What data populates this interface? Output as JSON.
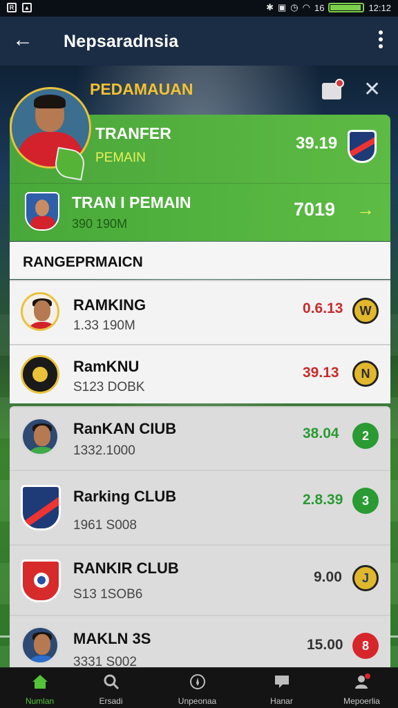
{
  "statusbar": {
    "time": "12:12",
    "battery_icon": "battery-icon",
    "signal_text": "16"
  },
  "appbar": {
    "title": "Nepsaradnsia",
    "back_icon": "arrow-left-icon",
    "menu_icon": "more-vert-icon"
  },
  "section": {
    "title": "PEDAMAUAN",
    "bag_icon": "bag-icon",
    "close_icon": "close-icon"
  },
  "transfer_card": {
    "title": "TRANFER",
    "subtitle": "PEMAIN",
    "value": "39.19",
    "badge_icon": "club-crest-icon"
  },
  "player_card": {
    "title": "TRAN I PEMAIN",
    "subtitle": "390 190M",
    "value": "7019",
    "arrow": "→"
  },
  "ranking": {
    "title": "RANGEPRMAICN",
    "rows": [
      {
        "name": "RAMKING",
        "sub": "1.33 190M",
        "value": "0.6.13",
        "value_color": "#c92b2b",
        "badge": "W",
        "badge_color": "#e1b72b",
        "avatar": "player-avatar"
      },
      {
        "name": "RamKNU",
        "sub": "S123 DOBK",
        "value": "39.13",
        "value_color": "#c92b2b",
        "badge": "N",
        "badge_color": "#e1b72b",
        "avatar": "club-logo"
      },
      {
        "name": "RanKAN CIUB",
        "sub": "1332.1000",
        "value": "38.04",
        "value_color": "#2a9a32",
        "badge": "2",
        "badge_color": "#2a9a32",
        "avatar": "player-avatar"
      },
      {
        "name": "Rarking CLUB",
        "sub": "1961 S008",
        "value": "2.8.39",
        "value_color": "#2a9a32",
        "badge": "3",
        "badge_color": "#2a9a32",
        "avatar": "club-crest"
      },
      {
        "name": "RANKIR CLUB",
        "sub": "S13 1SOB6",
        "value": "9.00",
        "value_color": "#333333",
        "badge": "J",
        "badge_color": "#e1b72b",
        "avatar": "club-crest-red"
      },
      {
        "name": "MAKLN 3S",
        "sub": "3331 S002",
        "value": "15.00",
        "value_color": "#333333",
        "badge": "8",
        "badge_color": "#d6262b",
        "avatar": "player-avatar"
      }
    ]
  },
  "bottom_nav": [
    {
      "label": "Numlan",
      "icon": "home-icon",
      "active": true
    },
    {
      "label": "Ersadi",
      "icon": "search-icon",
      "active": false
    },
    {
      "label": "Unpeonaa",
      "icon": "compass-icon",
      "active": false
    },
    {
      "label": "Hanar",
      "icon": "chat-icon",
      "active": false
    },
    {
      "label": "Mepoerlia",
      "icon": "profile-icon",
      "active": false
    }
  ]
}
